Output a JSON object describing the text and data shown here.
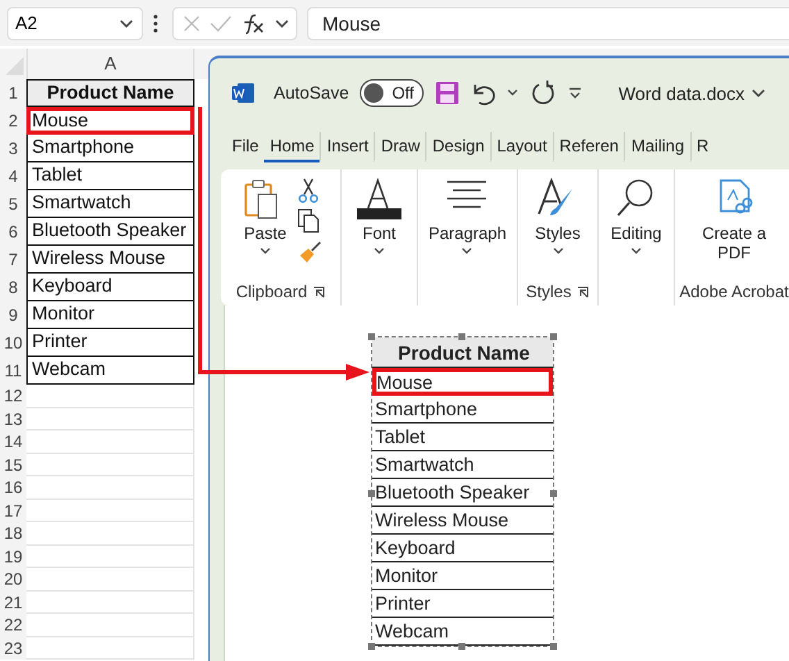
{
  "formula_bar": {
    "name_box": "A2",
    "formula": "Mouse"
  },
  "sheet": {
    "column": "A",
    "row_numbers": [
      "1",
      "2",
      "3",
      "4",
      "5",
      "6",
      "7",
      "8",
      "9",
      "10",
      "11",
      "12",
      "13",
      "14",
      "15",
      "16",
      "17",
      "18",
      "19",
      "20",
      "21",
      "22",
      "23"
    ],
    "header": "Product Name",
    "cells": [
      {
        "text": "Mouse",
        "highlighted": true
      },
      {
        "text": "Smartphone",
        "highlighted": false
      },
      {
        "text": "Tablet",
        "highlighted": false
      },
      {
        "text": "Smartwatch",
        "highlighted": false
      },
      {
        "text": "Bluetooth Speaker",
        "highlighted": false
      },
      {
        "text": "Wireless Mouse",
        "highlighted": false
      },
      {
        "text": "Keyboard",
        "highlighted": false
      },
      {
        "text": "Monitor",
        "highlighted": false
      },
      {
        "text": "Printer",
        "highlighted": false
      },
      {
        "text": "Webcam",
        "highlighted": false
      }
    ]
  },
  "word": {
    "autosave_label": "AutoSave",
    "autosave": {
      "label": "Off",
      "on": false
    },
    "document_title": "Word data.docx",
    "tabs": [
      {
        "label": "File",
        "selected": false
      },
      {
        "label": "Home",
        "selected": true
      },
      {
        "label": "Insert",
        "selected": false
      },
      {
        "label": "Draw",
        "selected": false
      },
      {
        "label": "Design",
        "selected": false
      },
      {
        "label": "Layout",
        "selected": false
      },
      {
        "label": "Referen",
        "selected": false
      },
      {
        "label": "Mailing",
        "selected": false
      },
      {
        "label": "R",
        "selected": false
      }
    ],
    "groups": [
      {
        "name": "Clipboard",
        "kind": "clipboard",
        "buttons": [
          "Paste"
        ],
        "launcher": true
      },
      {
        "kind": "font",
        "buttons": [
          "Font"
        ]
      },
      {
        "kind": "paragraph",
        "buttons": [
          "Paragraph"
        ]
      },
      {
        "name": "Styles",
        "kind": "styles",
        "buttons": [
          "Styles"
        ],
        "launcher": true
      },
      {
        "kind": "editing",
        "buttons": [
          "Editing"
        ]
      },
      {
        "name": "Adobe Acrobat",
        "kind": "pdf",
        "buttons": [
          "Create a PDF"
        ]
      }
    ],
    "table": {
      "header": "Product Name",
      "rows": [
        {
          "text": "Mouse",
          "highlighted": true
        },
        {
          "text": "Smartphone",
          "highlighted": false
        },
        {
          "text": "Tablet",
          "highlighted": false
        },
        {
          "text": "Smartwatch",
          "highlighted": false
        },
        {
          "text": "Bluetooth Speaker",
          "highlighted": false
        },
        {
          "text": "Wireless Mouse",
          "highlighted": false
        },
        {
          "text": "Keyboard",
          "highlighted": false
        },
        {
          "text": "Monitor",
          "highlighted": false
        },
        {
          "text": "Printer",
          "highlighted": false
        },
        {
          "text": "Webcam",
          "highlighted": false
        }
      ]
    }
  }
}
